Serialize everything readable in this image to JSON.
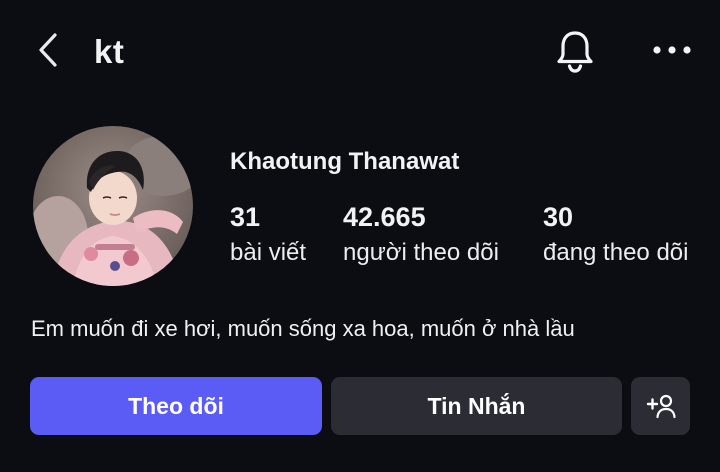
{
  "header": {
    "back_icon": "chevron-left-icon",
    "username": "kt",
    "bell_icon": "bell-icon",
    "more_icon": "more-horizontal-icon"
  },
  "profile": {
    "avatar_alt": "avatar",
    "display_name": "Khaotung Thanawat",
    "stats": {
      "posts": {
        "value": "31",
        "label": "bài viết"
      },
      "followers": {
        "value": "42.665",
        "label": "người theo dõi"
      },
      "following": {
        "value": "30",
        "label": "đang theo dõi"
      }
    },
    "bio": "Em muốn đi xe hơi, muốn sống xa hoa, muốn ở nhà lầu"
  },
  "actions": {
    "follow_label": "Theo dõi",
    "message_label": "Tin Nhắn",
    "suggest_icon": "add-person-icon"
  },
  "colors": {
    "background": "#0c0d13",
    "accent": "#5b5bf6",
    "secondary_button": "#2c2d34",
    "text": "#f2f2f4"
  }
}
